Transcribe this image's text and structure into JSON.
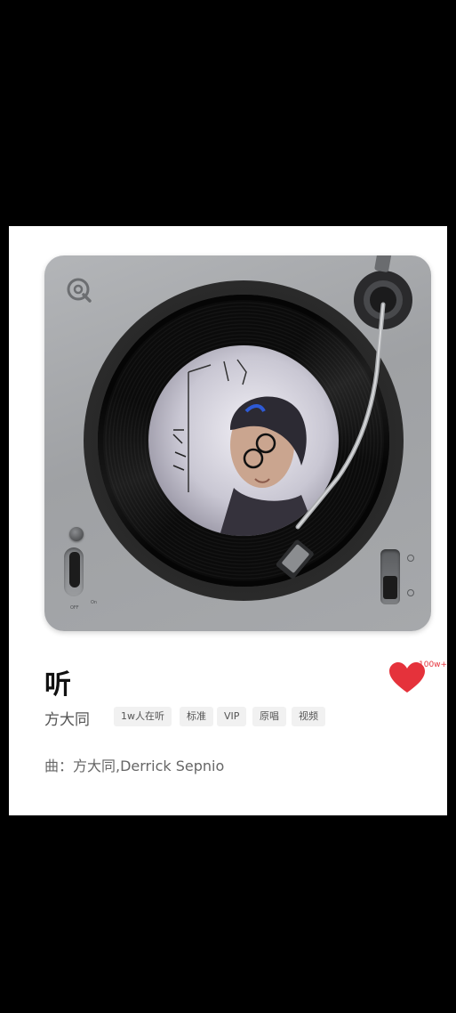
{
  "song": {
    "title": "听",
    "artist": "方大同",
    "composer_label": "曲：方大同,Derrick Sepnio"
  },
  "like": {
    "count_label": "100w+",
    "liked": true,
    "color": "#e5323b"
  },
  "tags": [
    "1w人在听",
    "标准",
    "VIP",
    "原唱",
    "视频"
  ],
  "player": {
    "power_off_label": "OFF",
    "power_on_label": "On",
    "logo_icon": "q-logo-icon",
    "album_art_icon": "album-cover-portrait"
  },
  "colors": {
    "background": "#000000",
    "card": "#ffffff",
    "accent": "#e5323b"
  }
}
